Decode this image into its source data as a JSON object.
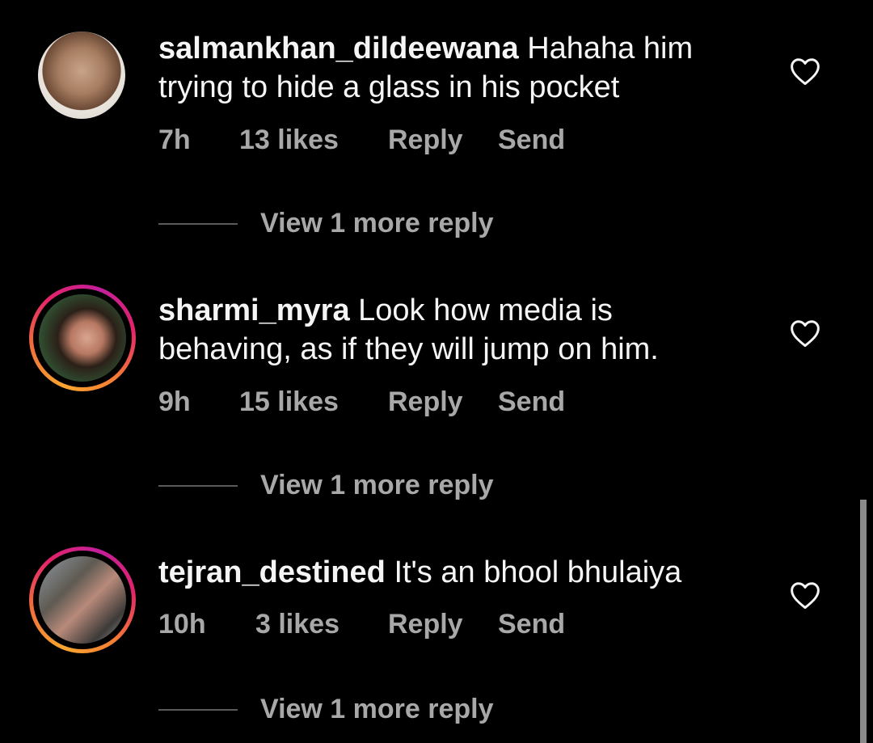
{
  "comments": [
    {
      "username": "salmankhan_dildeewana",
      "text": "Hahaha him trying to hide a glass in his pocket",
      "time": "7h",
      "likes": "13 likes",
      "reply_label": "Reply",
      "send_label": "Send",
      "view_replies": "View 1 more reply",
      "avatar_story_ring": false
    },
    {
      "username": "sharmi_myra",
      "text": "Look how media is behaving, as if they will jump on him.",
      "time": "9h",
      "likes": "15 likes",
      "reply_label": "Reply",
      "send_label": "Send",
      "view_replies": "View 1 more reply",
      "avatar_story_ring": true
    },
    {
      "username": "tejran_destined",
      "text": "It's an bhool bhulaiya",
      "time": "10h",
      "likes": "3 likes",
      "reply_label": "Reply",
      "send_label": "Send",
      "view_replies": "View 1 more reply",
      "avatar_story_ring": true
    }
  ],
  "icons": {
    "like": "heart-outline-icon"
  },
  "colors": {
    "background": "#000000",
    "primary_text": "#f5f5f5",
    "secondary_text": "#a8a8a8",
    "story_ring_start": "#f9a630",
    "story_ring_end": "#c21f9c"
  }
}
